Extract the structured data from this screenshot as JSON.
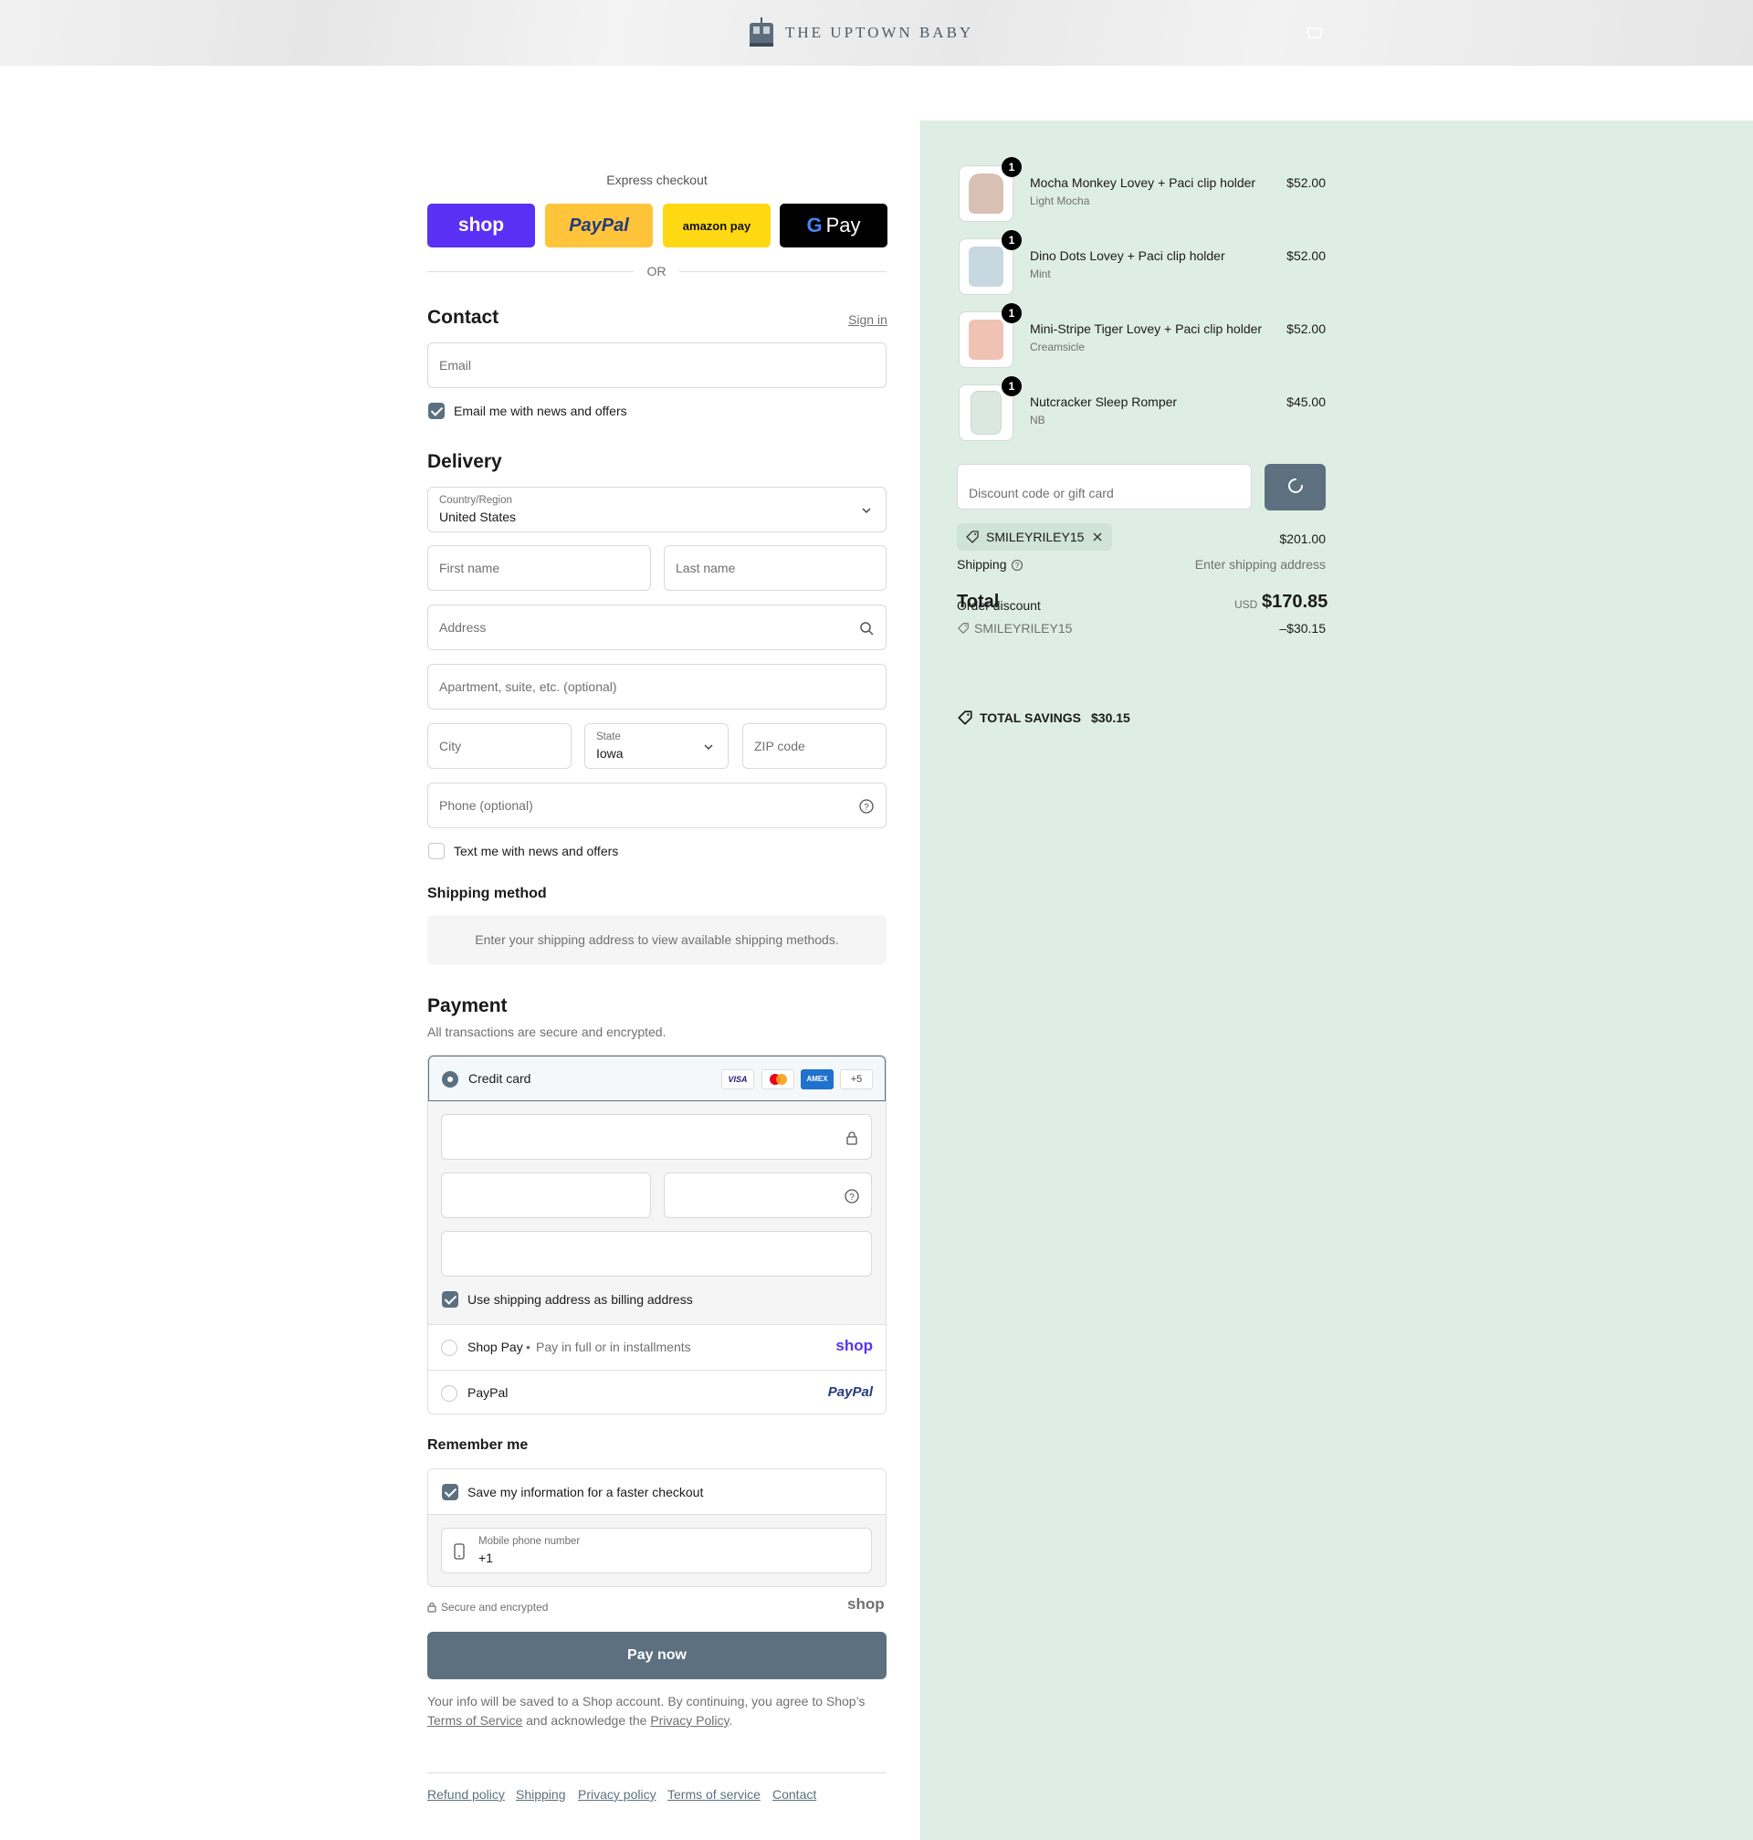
{
  "header": {
    "brand": "THE UPTOWN BABY"
  },
  "express": {
    "title": "Express checkout",
    "or": "OR",
    "shop_label": "shop",
    "paypal_label": "PayPal",
    "amazon_label": "amazon pay",
    "gpay_label": "Pay"
  },
  "contact": {
    "title": "Contact",
    "sign_in": "Sign in",
    "email_placeholder": "Email",
    "news_label": "Email me with news and offers"
  },
  "delivery": {
    "title": "Delivery",
    "country_label": "Country/Region",
    "country_value": "United States",
    "first_name": "First name",
    "last_name": "Last name",
    "address": "Address",
    "apartment": "Apartment, suite, etc. (optional)",
    "city": "City",
    "state_label": "State",
    "state_value": "Iowa",
    "zip": "ZIP code",
    "phone": "Phone (optional)",
    "text_label": "Text me with news and offers"
  },
  "shipping_method": {
    "title": "Shipping method",
    "message": "Enter your shipping address to view available shipping methods."
  },
  "payment": {
    "title": "Payment",
    "subtitle": "All transactions are secure and encrypted.",
    "credit_card": "Credit card",
    "more_cards": "+5",
    "visa": "VISA",
    "amex": "AMEX",
    "billing_label": "Use shipping address as billing address",
    "shop_pay": "Shop Pay",
    "shop_pay_sub": "Pay in full or in installments",
    "shop_pay_logo": "shop",
    "paypal": "PayPal",
    "paypal_logo": "PayPal"
  },
  "remember": {
    "title": "Remember me",
    "save_label": "Save my information for a faster checkout",
    "phone_label": "Mobile phone number",
    "phone_value": "+1",
    "secure": "Secure and encrypted",
    "shop_logo": "shop"
  },
  "pay_now": "Pay now",
  "disclaimer": {
    "pre": "Your info will be saved to a Shop account. By continuing, you agree to Shop’s",
    "tos": "Terms of Service",
    "mid": "and acknowledge the",
    "privacy": "Privacy Policy",
    "end": "."
  },
  "footer": [
    "Refund policy",
    "Shipping",
    "Privacy policy",
    "Terms of service",
    "Contact"
  ],
  "summary": {
    "items": [
      {
        "qty": "1",
        "name": "Mocha Monkey Lovey + Paci clip holder",
        "variant": "Light Mocha",
        "price": "$52.00",
        "color": "#d8c0b5"
      },
      {
        "qty": "1",
        "name": "Dino Dots Lovey + Paci clip holder",
        "variant": "Mint",
        "price": "$52.00",
        "color": "#c8d8e0"
      },
      {
        "qty": "1",
        "name": "Mini-Stripe Tiger Lovey + Paci clip holder",
        "variant": "Creamsicle",
        "price": "$52.00",
        "color": "#f0c2b4"
      },
      {
        "qty": "1",
        "name": "Nutcracker Sleep Romper",
        "variant": "NB",
        "price": "$45.00",
        "color": "#dbe8e1"
      }
    ],
    "discount_placeholder": "Discount code or gift card",
    "code": "SMILEYRILEY15",
    "subtotal": "$201.00",
    "shipping_label": "Shipping",
    "shipping_value": "Enter shipping address",
    "total_label": "Total",
    "order_discount_label": "Order discount",
    "currency": "USD",
    "total": "$170.85",
    "discount_code": "SMILEYRILEY15",
    "discount_amount": "–$30.15",
    "savings_label": "TOTAL SAVINGS",
    "savings_value": "$30.15"
  },
  "colors": {
    "accent": "#5c7080",
    "summary_bg": "#dfeee4",
    "shop_purple": "#5a31f4",
    "paypal_yellow": "#ffc439",
    "amazon_yellow": "#ffd814"
  }
}
